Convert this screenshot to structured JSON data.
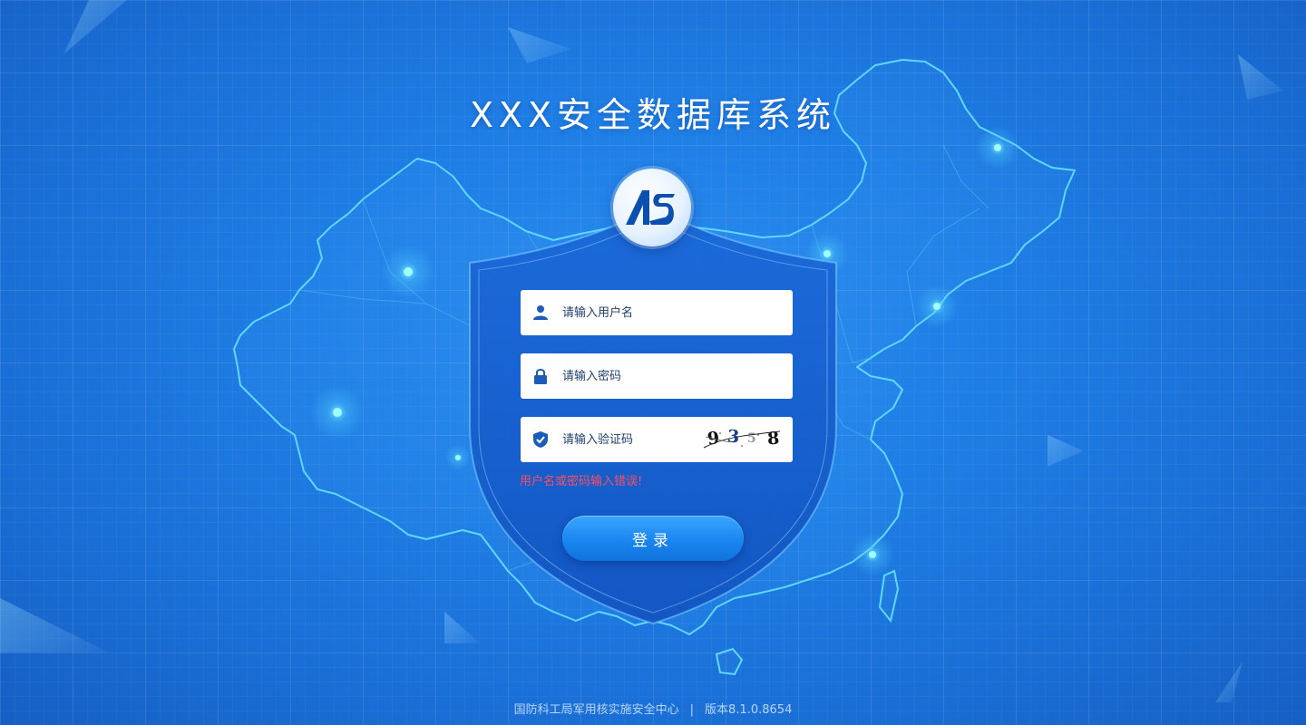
{
  "app": {
    "title": "XXX安全数据库系统",
    "logo_text": "AS"
  },
  "form": {
    "username": {
      "placeholder": "请输入用户名",
      "value": "",
      "icon": "user-icon"
    },
    "password": {
      "placeholder": "请输入密码",
      "value": "",
      "icon": "lock-icon"
    },
    "captcha": {
      "placeholder": "请输入验证码",
      "value": "",
      "icon": "shield-check-icon",
      "digits": [
        "9",
        "3",
        "5",
        "8"
      ]
    },
    "error_message": "用户名或密码输入错误!",
    "login_label": "登录"
  },
  "footer": {
    "organization": "国防科工局军用核实施安全中心",
    "separator": "|",
    "version": "版本8.1.0.8654"
  },
  "colors": {
    "background": "#1f7fe6",
    "map_outline": "#5fd8ff",
    "error": "#ff4d5e",
    "button": "#1a86f0",
    "field_icon": "#1a5cb8"
  }
}
